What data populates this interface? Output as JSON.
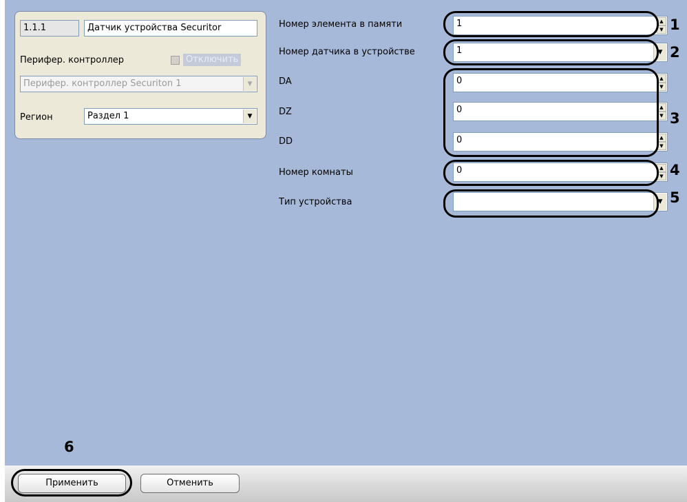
{
  "left_group": {
    "id_value": "1.1.1",
    "name_value": "Датчик устройства Securitor",
    "controller_label": "Перифер. контроллер",
    "disable_label": "Отключить",
    "controller_select": "Перифер. контроллер Securiton 1",
    "region_label": "Регион",
    "region_select": "Раздел 1"
  },
  "form": {
    "memory_label": "Номер элемента в памяти",
    "memory_value": "1",
    "sensor_label": "Номер датчика в устройстве",
    "sensor_value": "1",
    "da_label": "DA",
    "da_value": "0",
    "dz_label": "DZ",
    "dz_value": "0",
    "dd_label": "DD",
    "dd_value": "0",
    "room_label": "Номер комнаты",
    "room_value": "0",
    "type_label": "Тип устройства",
    "type_value": ""
  },
  "callouts": [
    "1",
    "2",
    "3",
    "4",
    "5",
    "6"
  ],
  "buttons": {
    "apply": "Применить",
    "cancel": "Отменить"
  }
}
